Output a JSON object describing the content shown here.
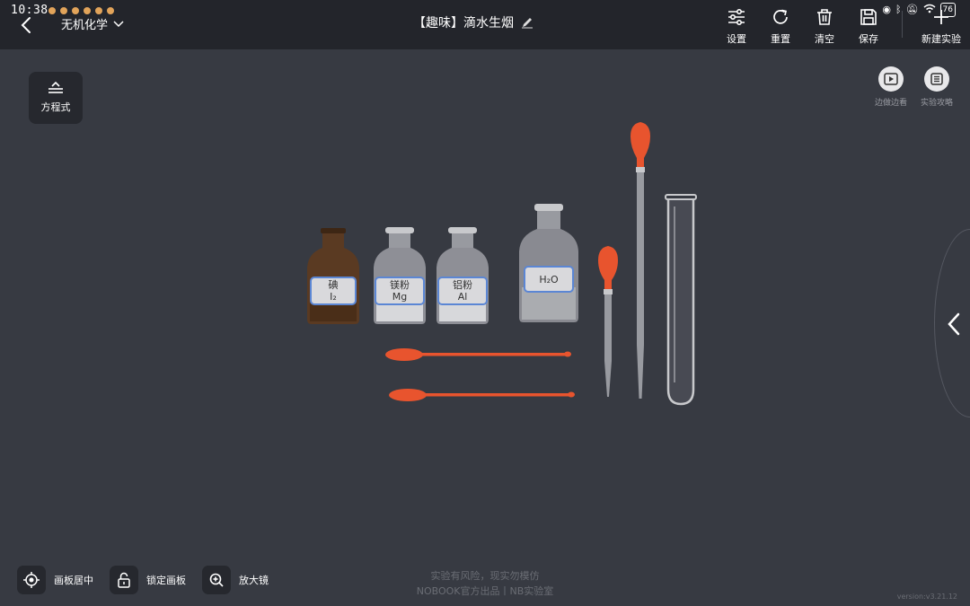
{
  "status": {
    "time": "10:38",
    "battery": "76",
    "icons": [
      "eye-icon",
      "bluetooth-icon",
      "mute-icon",
      "wifi-icon"
    ]
  },
  "header": {
    "category": "无机化学",
    "title": "【趣味】滴水生烟",
    "tools": [
      {
        "id": "settings",
        "label": "设置",
        "icon": "settings-sliders-icon"
      },
      {
        "id": "reset",
        "label": "重置",
        "icon": "refresh-icon"
      },
      {
        "id": "clear",
        "label": "清空",
        "icon": "trash-icon"
      },
      {
        "id": "save",
        "label": "保存",
        "icon": "save-icon"
      },
      {
        "id": "new",
        "label": "新建实验",
        "icon": "plus-icon"
      }
    ]
  },
  "left_panel": {
    "equation_label": "方程式"
  },
  "right_panel": {
    "watch_label": "边做边看",
    "guide_label": "实验攻略"
  },
  "reagents": [
    {
      "name": "碘",
      "formula": "I₂",
      "glass": "amber"
    },
    {
      "name": "镁粉",
      "formula": "Mg",
      "glass": "clear"
    },
    {
      "name": "铝粉",
      "formula": "Al",
      "glass": "clear"
    },
    {
      "name": "",
      "formula": "H₂O",
      "glass": "clear"
    }
  ],
  "bottom": {
    "center_label": "画板居中",
    "lock_label": "锁定画板",
    "magnifier_label": "放大镜"
  },
  "footer": {
    "line1": "实验有风险，现实勿模仿",
    "line2": "NOBOOK官方出品丨NB实验室"
  },
  "version": "version:v3.21.12",
  "colors": {
    "background": "#373a42",
    "topbar": "#23252b",
    "rubber_bulb": "#e8542e",
    "label_border": "#5b86d4",
    "amber_glass": "#5a3a22"
  }
}
